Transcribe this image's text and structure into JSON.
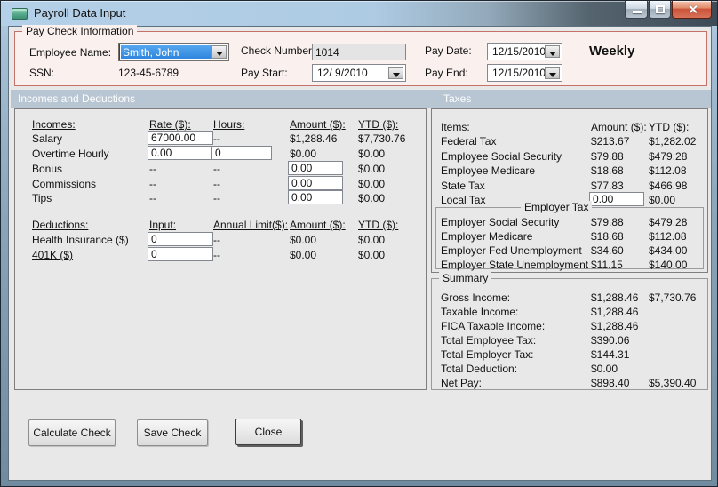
{
  "window": {
    "title": "Payroll Data Input"
  },
  "paycheck": {
    "legend": "Pay Check Information",
    "employee_name_label": "Employee Name:",
    "employee_name_value": "Smith, John",
    "ssn_label": "SSN:",
    "ssn_value": "123-45-6789",
    "check_number_label": "Check Number:",
    "check_number_value": "1014",
    "pay_start_label": "Pay Start:",
    "pay_start_value": "12/ 9/2010",
    "pay_date_label": "Pay Date:",
    "pay_date_value": "12/15/2010",
    "pay_end_label": "Pay End:",
    "pay_end_value": "12/15/2010",
    "frequency": "Weekly"
  },
  "section_headers": {
    "left": "Incomes and Deductions",
    "right": "Taxes"
  },
  "incomes": {
    "headers": {
      "name": "Incomes:",
      "rate": "Rate ($):",
      "hours": "Hours:",
      "amount": "Amount ($):",
      "ytd": "YTD ($):"
    },
    "rows": [
      {
        "name": "Salary",
        "rate": "67000.00",
        "hours": "--",
        "amount": "$1,288.46",
        "ytd": "$7,730.76"
      },
      {
        "name": "Overtime Hourly",
        "rate": "0.00",
        "hours": "0",
        "amount": "$0.00",
        "ytd": "$0.00"
      },
      {
        "name": "Bonus",
        "rate": "--",
        "hours": "--",
        "amount": "0.00",
        "ytd": "$0.00"
      },
      {
        "name": "Commissions",
        "rate": "--",
        "hours": "--",
        "amount": "0.00",
        "ytd": "$0.00"
      },
      {
        "name": "Tips",
        "rate": "--",
        "hours": "--",
        "amount": "0.00",
        "ytd": "$0.00"
      }
    ]
  },
  "deductions": {
    "headers": {
      "name": "Deductions:",
      "input": "Input:",
      "limit": "Annual Limit($):",
      "amount": "Amount ($):",
      "ytd": "YTD ($):"
    },
    "rows": [
      {
        "name": "Health Insurance  ($)",
        "input": "0",
        "limit": "--",
        "amount": "$0.00",
        "ytd": "$0.00"
      },
      {
        "name": "401K  ($)",
        "input": "0",
        "limit": "--",
        "amount": "$0.00",
        "ytd": "$0.00"
      }
    ]
  },
  "taxes": {
    "headers": {
      "name": "Items:",
      "amount": "Amount ($):",
      "ytd": "YTD ($):"
    },
    "rows": [
      {
        "name": "Federal Tax",
        "amount": "$213.67",
        "ytd": "$1,282.02"
      },
      {
        "name": "Employee Social Security",
        "amount": "$79.88",
        "ytd": "$479.28"
      },
      {
        "name": "Employee Medicare",
        "amount": "$18.68",
        "ytd": "$112.08"
      },
      {
        "name": "State Tax",
        "amount": "$77.83",
        "ytd": "$466.98"
      },
      {
        "name": "Local Tax",
        "amount": "0.00",
        "ytd": "$0.00"
      }
    ],
    "employer": {
      "title": "Employer Tax",
      "rows": [
        {
          "name": "Employer Social Security",
          "amount": "$79.88",
          "ytd": "$479.28"
        },
        {
          "name": "Employer Medicare",
          "amount": "$18.68",
          "ytd": "$112.08"
        },
        {
          "name": "Employer Fed Unemployment",
          "amount": "$34.60",
          "ytd": "$434.00"
        },
        {
          "name": "Employer State Unemployment",
          "amount": "$11.15",
          "ytd": "$140.00"
        }
      ]
    }
  },
  "summary": {
    "title": "Summary",
    "rows": [
      {
        "label": "Gross Income:",
        "amount": "$1,288.46",
        "ytd": "$7,730.76"
      },
      {
        "label": "Taxable Income:",
        "amount": "$1,288.46",
        "ytd": ""
      },
      {
        "label": "FICA Taxable Income:",
        "amount": "$1,288.46",
        "ytd": ""
      },
      {
        "label": "Total Employee Tax:",
        "amount": "$390.06",
        "ytd": ""
      },
      {
        "label": "Total Employer Tax:",
        "amount": "$144.31",
        "ytd": ""
      },
      {
        "label": "Total Deduction:",
        "amount": "$0.00",
        "ytd": ""
      },
      {
        "label": "Net Pay:",
        "amount": "$898.40",
        "ytd": "$5,390.40"
      }
    ]
  },
  "buttons": {
    "calculate": "Calculate Check",
    "save": "Save Check",
    "close": "Close"
  },
  "colors": {
    "group_border_red": "#c4716a",
    "section_band": "#b8c6d3",
    "selection_blue": "#3a90e4",
    "close_button_red": "#cd5339"
  }
}
